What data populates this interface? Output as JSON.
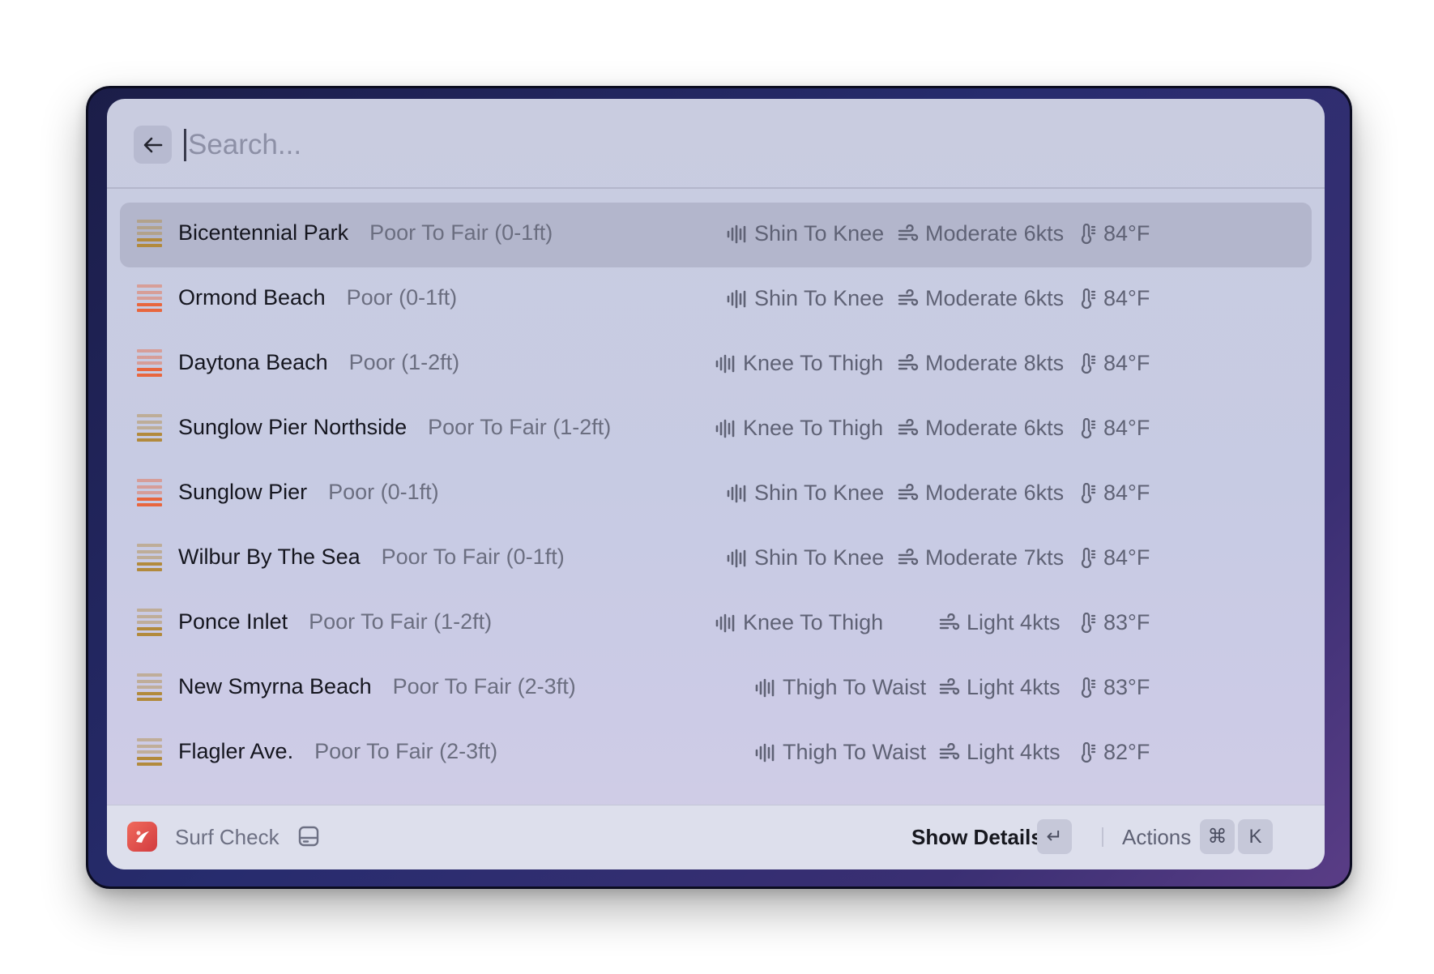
{
  "search": {
    "placeholder": "Search..."
  },
  "items": [
    {
      "title": "Bicentennial Park",
      "subtitle": "Poor To Fair (0-1ft)",
      "height": "Shin To Knee",
      "wind": "Moderate 6kts",
      "temp": "84°F",
      "rating_color": "#b28a3c",
      "selected": true
    },
    {
      "title": "Ormond Beach",
      "subtitle": "Poor (0-1ft)",
      "height": "Shin To Knee",
      "wind": "Moderate 6kts",
      "temp": "84°F",
      "rating_color": "#e8663e",
      "selected": false
    },
    {
      "title": "Daytona Beach",
      "subtitle": "Poor (1-2ft)",
      "height": "Knee To Thigh",
      "wind": "Moderate 8kts",
      "temp": "84°F",
      "rating_color": "#e8663e",
      "selected": false
    },
    {
      "title": "Sunglow Pier Northside",
      "subtitle": "Poor To Fair (1-2ft)",
      "height": "Knee To Thigh",
      "wind": "Moderate 6kts",
      "temp": "84°F",
      "rating_color": "#b28a3c",
      "selected": false
    },
    {
      "title": "Sunglow Pier",
      "subtitle": "Poor (0-1ft)",
      "height": "Shin To Knee",
      "wind": "Moderate 6kts",
      "temp": "84°F",
      "rating_color": "#e8663e",
      "selected": false
    },
    {
      "title": "Wilbur By The Sea",
      "subtitle": "Poor To Fair (0-1ft)",
      "height": "Shin To Knee",
      "wind": "Moderate 7kts",
      "temp": "84°F",
      "rating_color": "#b28a3c",
      "selected": false
    },
    {
      "title": "Ponce Inlet",
      "subtitle": "Poor To Fair (1-2ft)",
      "height": "Knee To Thigh",
      "wind": "Light 4kts",
      "temp": "83°F",
      "rating_color": "#b28a3c",
      "selected": false
    },
    {
      "title": "New Smyrna Beach",
      "subtitle": "Poor To Fair (2-3ft)",
      "height": "Thigh To Waist",
      "wind": "Light 4kts",
      "temp": "83°F",
      "rating_color": "#b28a3c",
      "selected": false
    },
    {
      "title": "Flagler Ave.",
      "subtitle": "Poor To Fair (2-3ft)",
      "height": "Thigh To Waist",
      "wind": "Light 4kts",
      "temp": "82°F",
      "rating_color": "#b28a3c",
      "selected": false
    }
  ],
  "footer": {
    "app_name": "Surf Check",
    "primary_action": "Show Details",
    "primary_key": "↵",
    "actions_label": "Actions",
    "actions_keys": [
      "⌘",
      "K"
    ]
  },
  "icons": {
    "back": "arrow-left-icon",
    "height": "waveform-icon",
    "wind": "wind-icon",
    "temp": "thermometer-icon",
    "app": "surf-check-app-icon",
    "footer_extra": "drive-icon"
  }
}
